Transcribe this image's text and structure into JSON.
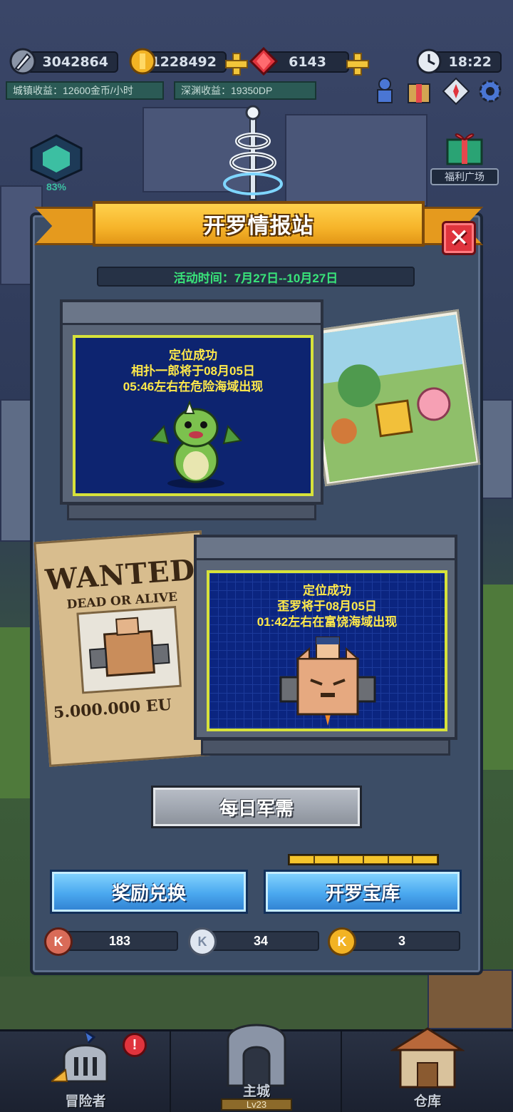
{
  "hud": {
    "power_value": "3042864",
    "gold_value": "1228492",
    "gem_value": "6143",
    "clock_value": "18:22",
    "town_income": "城镇收益：12600金币/小时",
    "abyss_income": "深渊收益：19350DP"
  },
  "side": {
    "cube_percent": "83%",
    "welfare_label": "福利广场"
  },
  "dialog": {
    "title": "开罗情报站",
    "event_time": "活动时间：7月27日--10月27日",
    "report1": {
      "line1": "定位成功",
      "line2": "相扑一郎将于08月05日",
      "line3": "05:46左右在危险海域出现"
    },
    "report2": {
      "line1": "定位成功",
      "line2": "歪罗将于08月05日",
      "line3": "01:42左右在富饶海域出现"
    },
    "poster": {
      "wanted": "WANTED",
      "dead_or_alive": "DEAD OR ALIVE",
      "bounty": "5.000.000 EU"
    },
    "daily_button": "每日军需",
    "progress_fraction": 1.0,
    "exchange_button": "奖励兑换",
    "vault_button": "开罗宝库",
    "tokens": {
      "bronze_icon": "K",
      "bronze_count": "183",
      "silver_icon": "K",
      "silver_count": "34",
      "gold_icon": "K",
      "gold_count": "3"
    }
  },
  "nav": {
    "adventurer": "冒险者",
    "main_city": "主城",
    "main_city_level": "Lv23",
    "warehouse": "仓库"
  },
  "colors": {
    "ribbon": "#f6b42a",
    "screen_text": "#ffe94a",
    "event_time_text": "#39e57a",
    "blue_button": "#4aa8ef",
    "close": "#e0343d"
  }
}
